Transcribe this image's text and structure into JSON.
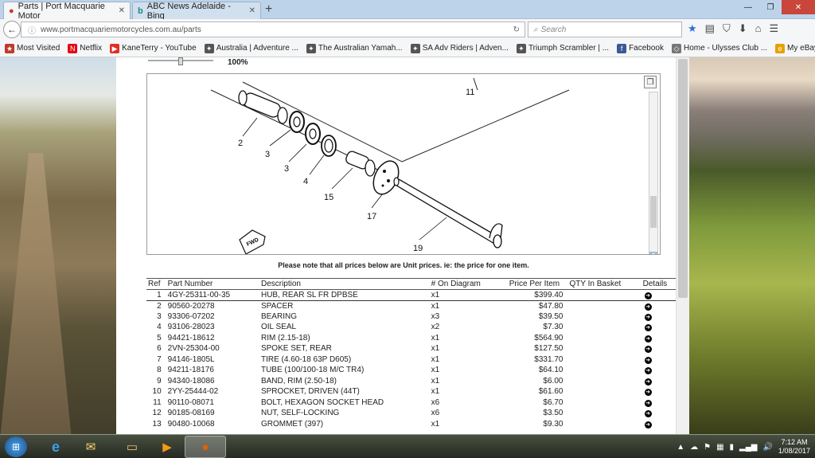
{
  "browser": {
    "tabs": [
      {
        "label": "Parts | Port Macquarie Motor",
        "active": true
      },
      {
        "label": "ABC News Adelaide - Bing",
        "active": false
      }
    ],
    "url": "www.portmacquariemotorcycles.com.au/parts",
    "search_placeholder": "Search",
    "bookmarks": [
      {
        "label": "Most Visited",
        "icon": "star-icon"
      },
      {
        "label": "Netflix",
        "icon": "netflix-icon"
      },
      {
        "label": "KaneTerry - YouTube",
        "icon": "youtube-icon"
      },
      {
        "label": "Australia | Adventure ...",
        "icon": "site-icon"
      },
      {
        "label": "The Australian Yamah...",
        "icon": "site-icon"
      },
      {
        "label": "SA Adv Riders | Adven...",
        "icon": "site-icon"
      },
      {
        "label": "Triumph Scrambler | ...",
        "icon": "site-icon"
      },
      {
        "label": "Facebook",
        "icon": "facebook-icon"
      },
      {
        "label": "Home - Ulysses Club ...",
        "icon": "site-icon"
      },
      {
        "label": "My eBay Summary",
        "icon": "ebay-icon"
      }
    ]
  },
  "diagram": {
    "zoom_label": "100%",
    "part_labels": [
      "2",
      "3",
      "3",
      "4",
      "15",
      "17",
      "19",
      "11"
    ],
    "fwd_label": "FWD"
  },
  "note": "Please note that all prices below are Unit prices. ie: the price for one item.",
  "table": {
    "headers": [
      "Ref",
      "Part Number",
      "Description",
      "# On Diagram",
      "Price Per Item",
      "QTY In Basket",
      "Details"
    ],
    "rows": [
      {
        "ref": "1",
        "part": "4GY-25311-00-35",
        "desc": "HUB, REAR SL FR DPBSE",
        "qty": "x1",
        "price": "$399.40"
      },
      {
        "ref": "2",
        "part": "90560-20278",
        "desc": "SPACER",
        "qty": "x1",
        "price": "$47.80"
      },
      {
        "ref": "3",
        "part": "93306-07202",
        "desc": "BEARING",
        "qty": "x3",
        "price": "$39.50"
      },
      {
        "ref": "4",
        "part": "93106-28023",
        "desc": "OIL SEAL",
        "qty": "x2",
        "price": "$7.30"
      },
      {
        "ref": "5",
        "part": "94421-18612",
        "desc": "RIM (2.15-18)",
        "qty": "x1",
        "price": "$564.90"
      },
      {
        "ref": "6",
        "part": "2VN-25304-00",
        "desc": "SPOKE SET, REAR",
        "qty": "x1",
        "price": "$127.50"
      },
      {
        "ref": "7",
        "part": "94146-1805L",
        "desc": "TIRE (4.60-18 63P D605)",
        "qty": "x1",
        "price": "$331.70"
      },
      {
        "ref": "8",
        "part": "94211-18176",
        "desc": "TUBE (100/100-18 M/C TR4)",
        "qty": "x1",
        "price": "$64.10"
      },
      {
        "ref": "9",
        "part": "94340-18086",
        "desc": "BAND, RIM (2.50-18)",
        "qty": "x1",
        "price": "$6.00"
      },
      {
        "ref": "10",
        "part": "2YY-25444-02",
        "desc": "SPROCKET, DRIVEN (44T)",
        "qty": "x1",
        "price": "$61.60"
      },
      {
        "ref": "11",
        "part": "90110-08071",
        "desc": "BOLT, HEXAGON SOCKET HEAD",
        "qty": "x6",
        "price": "$6.70"
      },
      {
        "ref": "12",
        "part": "90185-08169",
        "desc": "NUT, SELF-LOCKING",
        "qty": "x6",
        "price": "$3.50"
      },
      {
        "ref": "13",
        "part": "90480-10068",
        "desc": "GROMMET (397)",
        "qty": "x1",
        "price": "$9.30"
      }
    ]
  },
  "taskbar": {
    "time": "7:12 AM",
    "date": "1/08/2017"
  }
}
